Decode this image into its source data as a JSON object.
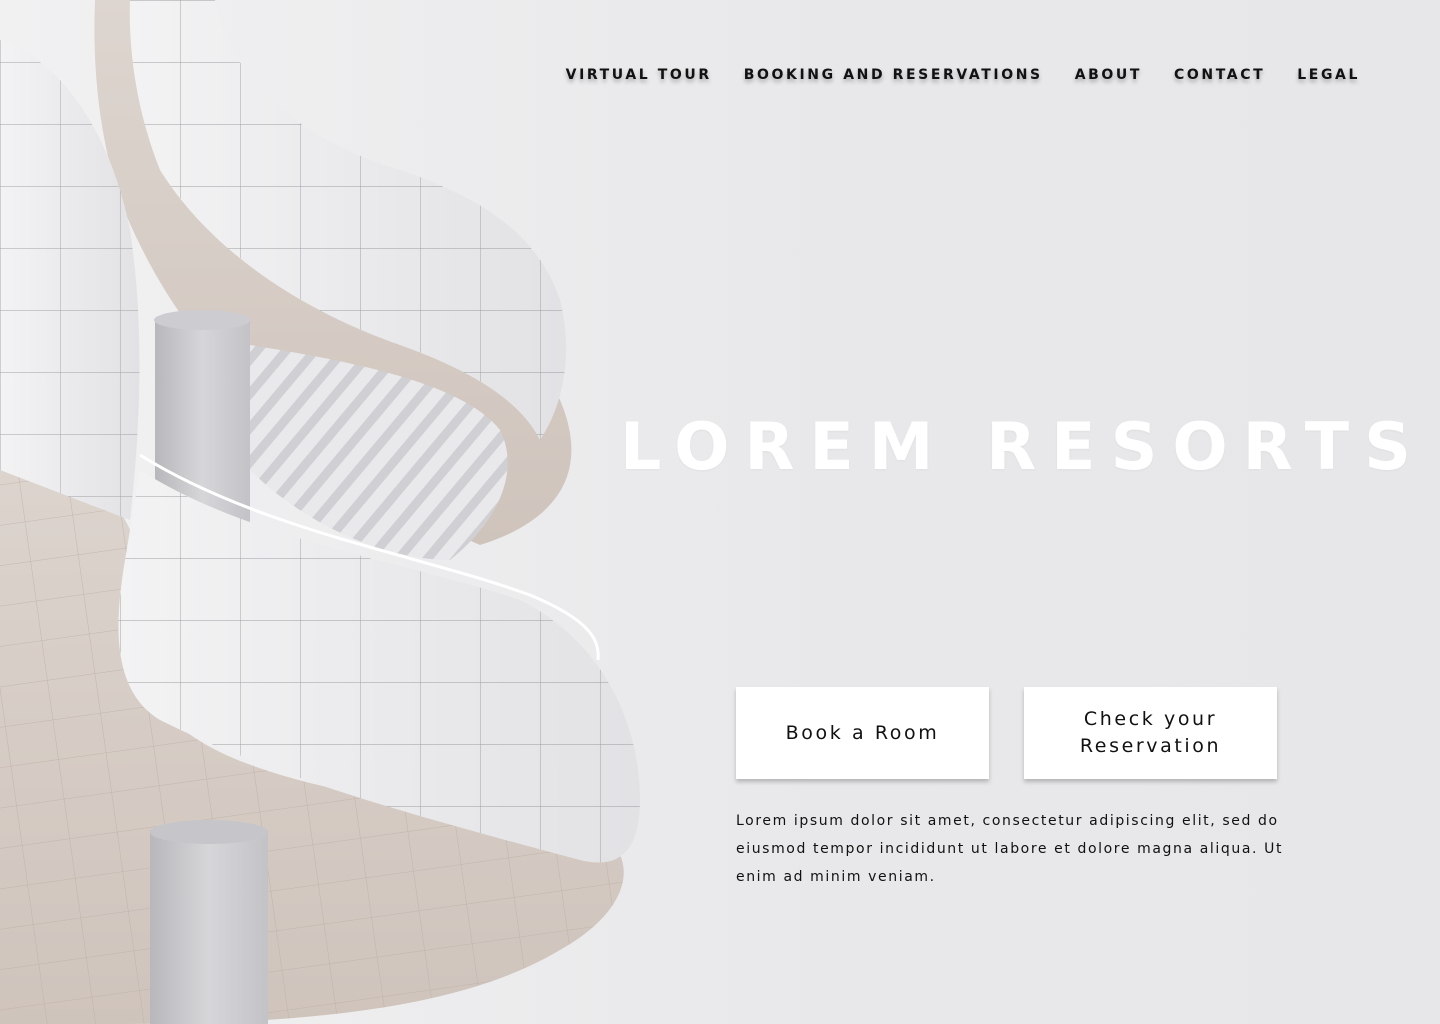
{
  "nav": {
    "items": [
      {
        "label": "VIRTUAL TOUR"
      },
      {
        "label": "BOOKING AND RESERVATIONS"
      },
      {
        "label": "ABOUT"
      },
      {
        "label": "CONTACT"
      },
      {
        "label": "LEGAL"
      }
    ]
  },
  "hero": {
    "title": "LOREM RESORTS",
    "buttons": {
      "book": "Book a Room",
      "check": "Check your Reservation"
    },
    "description": "Lorem ipsum dolor sit amet, consectetur adipiscing elit, sed do eiusmod tempor incididunt ut labore et dolore magna aliqua. Ut enim ad minim veniam."
  },
  "colors": {
    "background": "#e8e8ea",
    "text": "#111111",
    "title": "#ffffff",
    "button_bg": "#ffffff"
  }
}
